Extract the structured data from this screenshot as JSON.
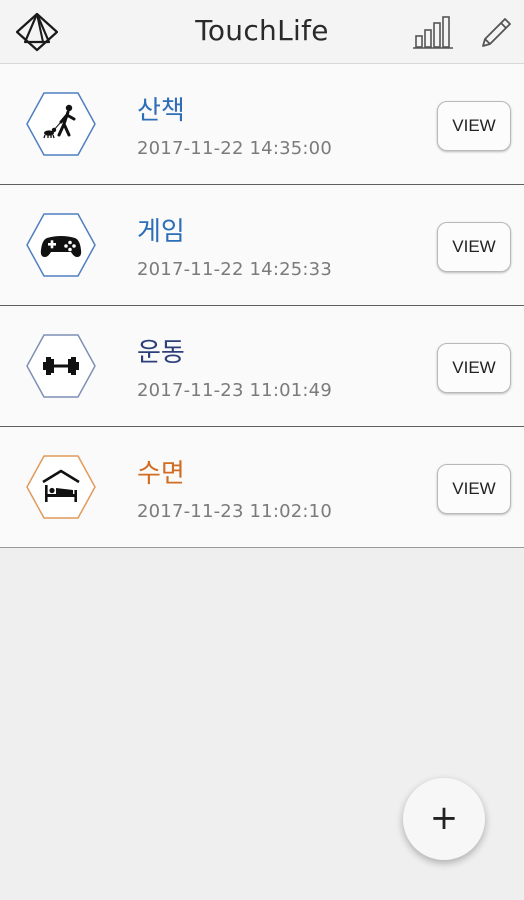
{
  "app": {
    "title": "TouchLife",
    "logo_icon": "triangle-logo-icon",
    "chart_icon": "bar-chart-icon",
    "edit_icon": "pencil-icon"
  },
  "entries": [
    {
      "name": "산책",
      "date": "2017-11-22 14:35:00",
      "icon": "dog-walk-icon",
      "color": "#2e6db8",
      "hex_color": "#4f7fc1",
      "view_label": "VIEW"
    },
    {
      "name": "게임",
      "date": "2017-11-22 14:25:33",
      "icon": "gamepad-icon",
      "color": "#2e6db8",
      "hex_color": "#4f7fc1",
      "view_label": "VIEW"
    },
    {
      "name": "운동",
      "date": "2017-11-23 11:01:49",
      "icon": "dumbbell-icon",
      "color": "#2c3f7a",
      "hex_color": "#7f8fb5",
      "view_label": "VIEW"
    },
    {
      "name": "수면",
      "date": "2017-11-23 11:02:10",
      "icon": "bed-icon",
      "color": "#d06d23",
      "hex_color": "#e09a5a",
      "view_label": "VIEW"
    }
  ],
  "fab": {
    "label": "+",
    "icon": "plus-icon"
  }
}
